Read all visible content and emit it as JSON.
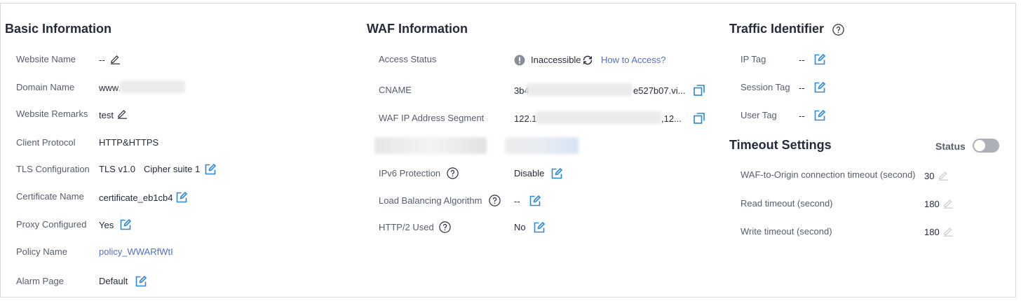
{
  "colors": {
    "accent": "#526ecc",
    "edit_blue": "#2d86d8",
    "text": "#252b3a",
    "label": "#575d6c",
    "muted": "#adb0b8"
  },
  "basic": {
    "title": "Basic Information",
    "website_name_label": "Website Name",
    "website_name_value": "--",
    "domain_name_label": "Domain Name",
    "domain_name_value": "www.",
    "website_remarks_label": "Website Remarks",
    "website_remarks_value": "test",
    "client_protocol_label": "Client Protocol",
    "client_protocol_value": "HTTP&HTTPS",
    "tls_label": "TLS Configuration",
    "tls_version": "TLS v1.0",
    "tls_cipher": "Cipher suite 1",
    "certificate_label": "Certificate Name",
    "certificate_value": "certificate_eb1cb4",
    "proxy_label": "Proxy Configured",
    "proxy_value": "Yes",
    "policy_label": "Policy Name",
    "policy_value": "policy_WWARfWtI",
    "alarm_label": "Alarm Page",
    "alarm_value": "Default"
  },
  "waf": {
    "title": "WAF Information",
    "access_status_label": "Access Status",
    "access_status_value": "Inaccessible",
    "how_to_access": "How to Access?",
    "cname_label": "CNAME",
    "cname_prefix": "3b4",
    "cname_suffix": "e527b07.vi...",
    "ip_segment_label": "WAF IP Address Segment",
    "ip_prefix": "122.1",
    "ip_suffix": ",12...",
    "ipv6_label": "IPv6 Protection",
    "ipv6_value": "Disable",
    "lb_label": "Load Balancing Algorithm",
    "lb_value": "--",
    "http2_label": "HTTP/2 Used",
    "http2_value": "No"
  },
  "traffic": {
    "title": "Traffic Identifier",
    "ip_tag_label": "IP Tag",
    "ip_tag_value": "--",
    "session_tag_label": "Session Tag",
    "session_tag_value": "--",
    "user_tag_label": "User Tag",
    "user_tag_value": "--"
  },
  "timeout": {
    "title": "Timeout Settings",
    "status_label": "Status",
    "status_on": false,
    "connection_label": "WAF-to-Origin connection timeout (second)",
    "connection_value": "30",
    "read_label": "Read timeout (second)",
    "read_value": "180",
    "write_label": "Write timeout (second)",
    "write_value": "180"
  }
}
